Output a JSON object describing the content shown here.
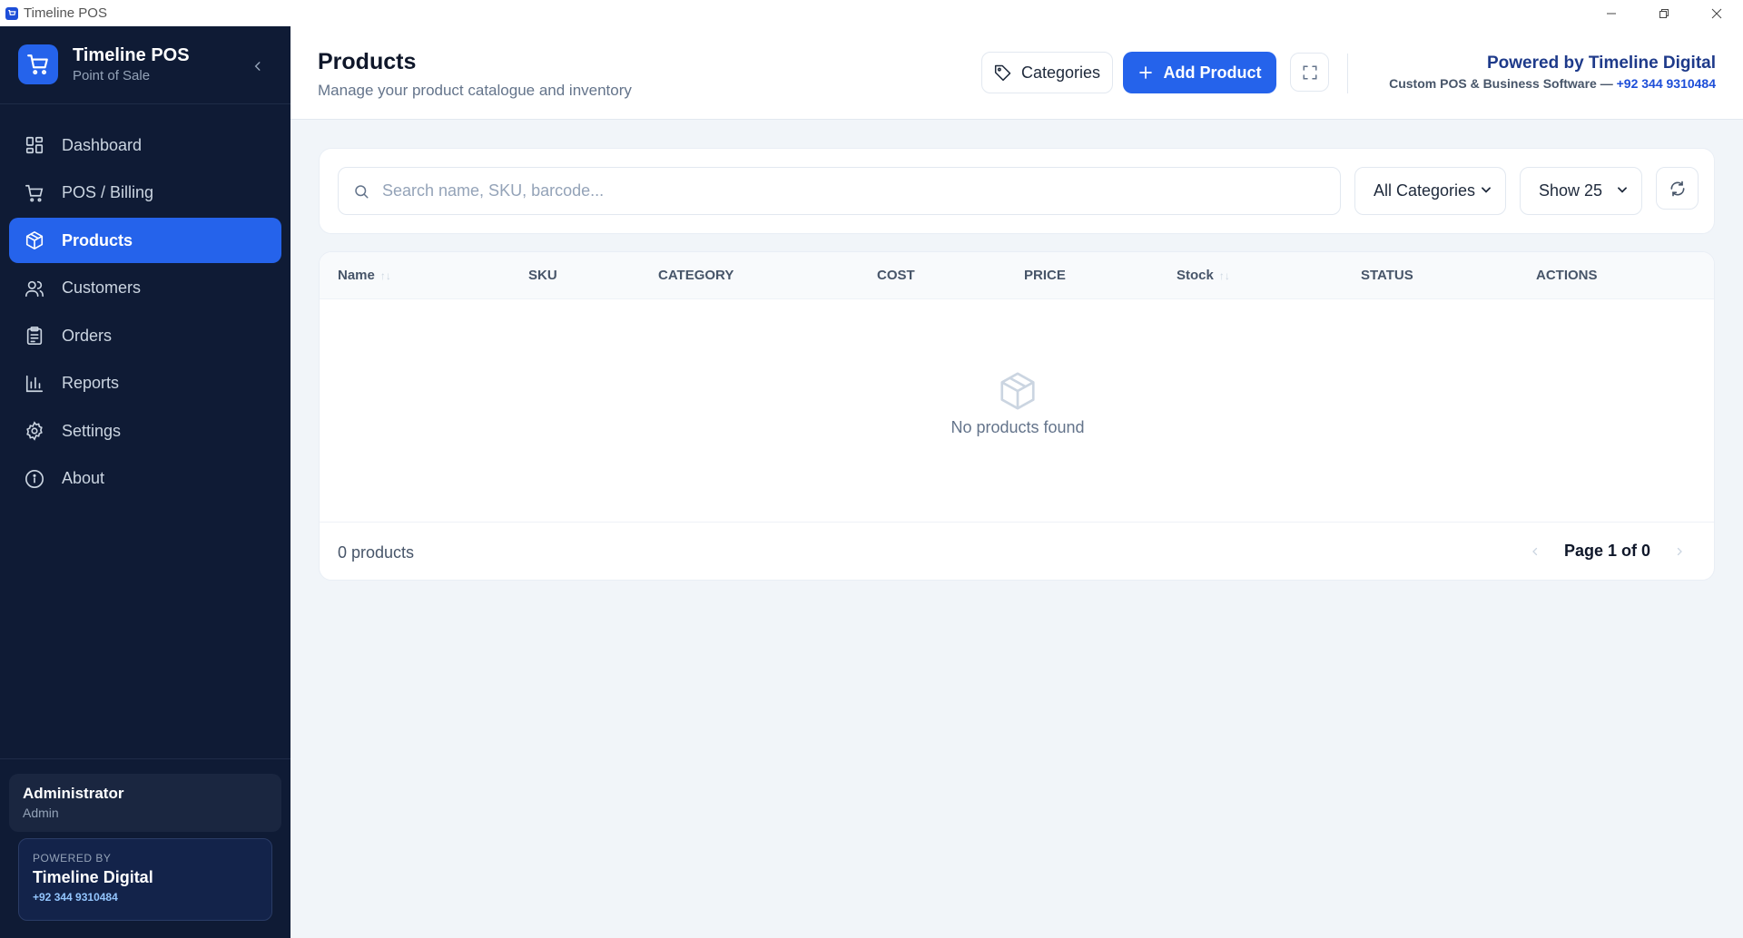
{
  "window": {
    "title": "Timeline POS",
    "controls": [
      "minimize-icon",
      "restore-icon",
      "close-icon"
    ]
  },
  "brand": {
    "name": "Timeline POS",
    "subtitle": "Point of Sale"
  },
  "sidebar": {
    "items": [
      {
        "label": "Dashboard",
        "icon": "dashboard-icon",
        "active": false
      },
      {
        "label": "POS / Billing",
        "icon": "cart-icon",
        "active": false
      },
      {
        "label": "Products",
        "icon": "package-icon",
        "active": true
      },
      {
        "label": "Customers",
        "icon": "users-icon",
        "active": false
      },
      {
        "label": "Orders",
        "icon": "clipboard-icon",
        "active": false
      },
      {
        "label": "Reports",
        "icon": "bar-chart-icon",
        "active": false
      },
      {
        "label": "Settings",
        "icon": "gear-icon",
        "active": false
      },
      {
        "label": "About",
        "icon": "info-icon",
        "active": false
      }
    ],
    "user": {
      "name": "Administrator",
      "role": "Admin"
    },
    "powered": {
      "label": "POWERED BY",
      "name": "Timeline Digital",
      "phone": "+92 344 9310484"
    }
  },
  "header": {
    "title": "Products",
    "subtitle": "Manage your product catalogue and inventory",
    "categories_label": "Categories",
    "add_label": "Add Product",
    "powered_title": "Powered by Timeline Digital",
    "powered_sub": "Custom POS & Business Software —",
    "powered_phone": "+92 344 9310484"
  },
  "filters": {
    "search_placeholder": "Search name, SKU, barcode...",
    "search_value": "",
    "category_selected": "All Categories",
    "show_selected": "Show 25"
  },
  "table": {
    "columns": [
      "Name",
      "SKU",
      "CATEGORY",
      "COST",
      "PRICE",
      "Stock",
      "STATUS",
      "ACTIONS"
    ],
    "empty_text": "No products found",
    "count_text": "0 products",
    "page_text": "Page 1 of 0"
  },
  "colors": {
    "sidebar_bg": "#0f1b35",
    "accent": "#2563eb",
    "page_bg": "#f1f5f9",
    "powered_title": "#1e3a8a"
  }
}
